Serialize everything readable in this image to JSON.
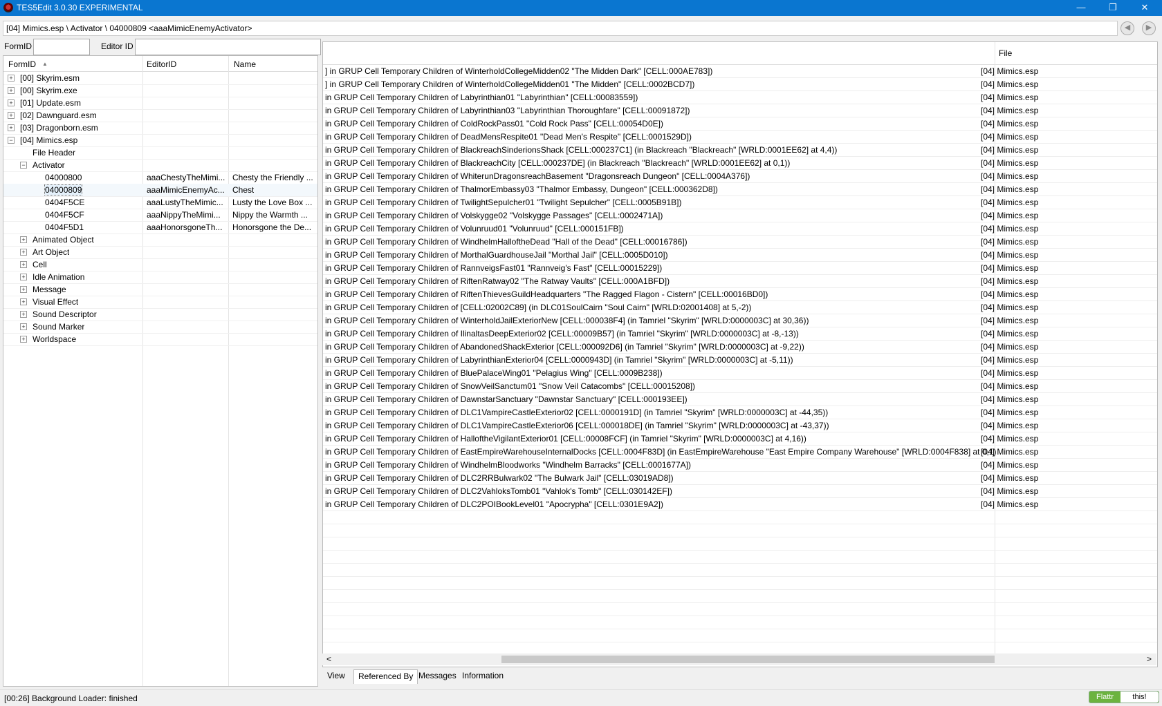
{
  "window": {
    "title": "TES5Edit 3.0.30 EXPERIMENTAL",
    "minimize": "—",
    "restore": "❐",
    "close": "✕"
  },
  "path": "[04] Mimics.esp \\ Activator \\ 04000809 <aaaMimicEnemyActivator>",
  "nav": {
    "back": "◀",
    "forward": "▶"
  },
  "filters": {
    "formid_label": "FormID",
    "formid_value": "",
    "editorid_label": "Editor ID",
    "editorid_value": ""
  },
  "tree": {
    "headers": {
      "formid": "FormID",
      "editorid": "EditorID",
      "name": "Name",
      "sort_indicator": "▲"
    },
    "rows": [
      {
        "exp": "+",
        "formid": "[00] Skyrim.esm",
        "editorid": "",
        "name": ""
      },
      {
        "exp": "+",
        "formid": "[00] Skyrim.exe",
        "editorid": "",
        "name": ""
      },
      {
        "exp": "+",
        "formid": "[01] Update.esm",
        "editorid": "",
        "name": ""
      },
      {
        "exp": "+",
        "formid": "[02] Dawnguard.esm",
        "editorid": "",
        "name": ""
      },
      {
        "exp": "+",
        "formid": "[03] Dragonborn.esm",
        "editorid": "",
        "name": ""
      },
      {
        "exp": "−",
        "formid": "[04] Mimics.esp",
        "editorid": "",
        "name": ""
      },
      {
        "exp": "",
        "formid": "File Header",
        "editorid": "",
        "name": ""
      },
      {
        "exp": "−",
        "formid": "Activator",
        "editorid": "",
        "name": ""
      },
      {
        "exp": "",
        "formid": "04000800",
        "editorid": "aaaChestyTheMimi...",
        "name": "Chesty the Friendly ..."
      },
      {
        "exp": "",
        "formid": "04000809",
        "editorid": "aaaMimicEnemyAc...",
        "name": "Chest"
      },
      {
        "exp": "",
        "formid": "0404F5CE",
        "editorid": "aaaLustyTheMimic...",
        "name": "Lusty the Love Box ..."
      },
      {
        "exp": "",
        "formid": "0404F5CF",
        "editorid": "aaaNippyTheMimi...",
        "name": "Nippy the Warmth ..."
      },
      {
        "exp": "",
        "formid": "0404F5D1",
        "editorid": "aaaHonorsgoneTh...",
        "name": "Honorsgone the De..."
      },
      {
        "exp": "+",
        "formid": "Animated Object",
        "editorid": "",
        "name": ""
      },
      {
        "exp": "+",
        "formid": "Art Object",
        "editorid": "",
        "name": ""
      },
      {
        "exp": "+",
        "formid": "Cell",
        "editorid": "",
        "name": ""
      },
      {
        "exp": "+",
        "formid": "Idle Animation",
        "editorid": "",
        "name": ""
      },
      {
        "exp": "+",
        "formid": "Message",
        "editorid": "",
        "name": ""
      },
      {
        "exp": "+",
        "formid": "Visual Effect",
        "editorid": "",
        "name": ""
      },
      {
        "exp": "+",
        "formid": "Sound Descriptor",
        "editorid": "",
        "name": ""
      },
      {
        "exp": "+",
        "formid": "Sound Marker",
        "editorid": "",
        "name": ""
      },
      {
        "exp": "+",
        "formid": "Worldspace",
        "editorid": "",
        "name": ""
      }
    ]
  },
  "refs": {
    "header_file": "File",
    "rows": [
      {
        "ref": "] in GRUP Cell Temporary Children of WinterholdCollegeMidden02 \"The Midden Dark\" [CELL:000AE783])",
        "file": "[04] Mimics.esp"
      },
      {
        "ref": "] in GRUP Cell Temporary Children of WinterholdCollegeMidden01 \"The Midden\" [CELL:0002BCD7])",
        "file": "[04] Mimics.esp"
      },
      {
        "ref": " in GRUP Cell Temporary Children of Labyrinthian01 \"Labyrinthian\" [CELL:00083559])",
        "file": "[04] Mimics.esp"
      },
      {
        "ref": " in GRUP Cell Temporary Children of Labyrinthian03 \"Labyrinthian Thoroughfare\" [CELL:00091872])",
        "file": "[04] Mimics.esp"
      },
      {
        "ref": " in GRUP Cell Temporary Children of ColdRockPass01 \"Cold Rock Pass\" [CELL:00054D0E])",
        "file": "[04] Mimics.esp"
      },
      {
        "ref": " in GRUP Cell Temporary Children of DeadMensRespite01 \"Dead Men's Respite\" [CELL:0001529D])",
        "file": "[04] Mimics.esp"
      },
      {
        "ref": " in GRUP Cell Temporary Children of BlackreachSinderionsShack [CELL:000237C1] (in Blackreach \"Blackreach\" [WRLD:0001EE62] at 4,4))",
        "file": "[04] Mimics.esp"
      },
      {
        "ref": " in GRUP Cell Temporary Children of BlackreachCity [CELL:000237DE] (in Blackreach \"Blackreach\" [WRLD:0001EE62] at 0,1))",
        "file": "[04] Mimics.esp"
      },
      {
        "ref": " in GRUP Cell Temporary Children of WhiterunDragonsreachBasement \"Dragonsreach Dungeon\" [CELL:0004A376])",
        "file": "[04] Mimics.esp"
      },
      {
        "ref": " in GRUP Cell Temporary Children of ThalmorEmbassy03 \"Thalmor Embassy, Dungeon\" [CELL:000362D8])",
        "file": "[04] Mimics.esp"
      },
      {
        "ref": " in GRUP Cell Temporary Children of TwilightSepulcher01 \"Twilight Sepulcher\" [CELL:0005B91B])",
        "file": "[04] Mimics.esp"
      },
      {
        "ref": " in GRUP Cell Temporary Children of Volskygge02 \"Volskygge Passages\" [CELL:0002471A])",
        "file": "[04] Mimics.esp"
      },
      {
        "ref": " in GRUP Cell Temporary Children of Volunruud01 \"Volunruud\" [CELL:000151FB])",
        "file": "[04] Mimics.esp"
      },
      {
        "ref": " in GRUP Cell Temporary Children of WindhelmHalloftheDead \"Hall of the Dead\" [CELL:00016786])",
        "file": "[04] Mimics.esp"
      },
      {
        "ref": " in GRUP Cell Temporary Children of MorthalGuardhouseJail \"Morthal Jail\" [CELL:0005D010])",
        "file": "[04] Mimics.esp"
      },
      {
        "ref": " in GRUP Cell Temporary Children of RannveigsFast01 \"Rannveig's Fast\" [CELL:00015229])",
        "file": "[04] Mimics.esp"
      },
      {
        "ref": " in GRUP Cell Temporary Children of RiftenRatway02 \"The Ratway Vaults\" [CELL:000A1BFD])",
        "file": "[04] Mimics.esp"
      },
      {
        "ref": " in GRUP Cell Temporary Children of RiftenThievesGuildHeadquarters \"The Ragged Flagon - Cistern\" [CELL:00016BD0])",
        "file": "[04] Mimics.esp"
      },
      {
        "ref": " in GRUP Cell Temporary Children of [CELL:02002C89] (in DLC01SoulCairn \"Soul Cairn\" [WRLD:02001408] at 5,-2))",
        "file": "[04] Mimics.esp"
      },
      {
        "ref": " in GRUP Cell Temporary Children of WinterholdJailExteriorNew [CELL:000038F4] (in Tamriel \"Skyrim\" [WRLD:0000003C] at 30,36))",
        "file": "[04] Mimics.esp"
      },
      {
        "ref": " in GRUP Cell Temporary Children of IlinaltasDeepExterior02 [CELL:00009B57] (in Tamriel \"Skyrim\" [WRLD:0000003C] at -8,-13))",
        "file": "[04] Mimics.esp"
      },
      {
        "ref": " in GRUP Cell Temporary Children of AbandonedShackExterior [CELL:000092D6] (in Tamriel \"Skyrim\" [WRLD:0000003C] at -9,22))",
        "file": "[04] Mimics.esp"
      },
      {
        "ref": " in GRUP Cell Temporary Children of LabyrinthianExterior04 [CELL:0000943D] (in Tamriel \"Skyrim\" [WRLD:0000003C] at -5,11))",
        "file": "[04] Mimics.esp"
      },
      {
        "ref": " in GRUP Cell Temporary Children of BluePalaceWing01 \"Pelagius Wing\" [CELL:0009B238])",
        "file": "[04] Mimics.esp"
      },
      {
        "ref": " in GRUP Cell Temporary Children of SnowVeilSanctum01 \"Snow Veil Catacombs\" [CELL:00015208])",
        "file": "[04] Mimics.esp"
      },
      {
        "ref": " in GRUP Cell Temporary Children of DawnstarSanctuary \"Dawnstar Sanctuary\" [CELL:000193EE])",
        "file": "[04] Mimics.esp"
      },
      {
        "ref": " in GRUP Cell Temporary Children of DLC1VampireCastleExterior02 [CELL:0000191D] (in Tamriel \"Skyrim\" [WRLD:0000003C] at -44,35))",
        "file": "[04] Mimics.esp"
      },
      {
        "ref": " in GRUP Cell Temporary Children of DLC1VampireCastleExterior06 [CELL:000018DE] (in Tamriel \"Skyrim\" [WRLD:0000003C] at -43,37))",
        "file": "[04] Mimics.esp"
      },
      {
        "ref": " in GRUP Cell Temporary Children of HalloftheVigilantExterior01 [CELL:00008FCF] (in Tamriel \"Skyrim\" [WRLD:0000003C] at 4,16))",
        "file": "[04] Mimics.esp"
      },
      {
        "ref": " in GRUP Cell Temporary Children of EastEmpireWarehouseInternalDocks [CELL:0004F83D] (in EastEmpireWarehouse \"East Empire Company Warehouse\" [WRLD:0004F838] at 0,1))",
        "file": "[04] Mimics.esp"
      },
      {
        "ref": " in GRUP Cell Temporary Children of WindhelmBloodworks \"Windhelm Barracks\" [CELL:0001677A])",
        "file": "[04] Mimics.esp"
      },
      {
        "ref": " in GRUP Cell Temporary Children of DLC2RRBulwark02 \"The Bulwark Jail\" [CELL:03019AD8])",
        "file": "[04] Mimics.esp"
      },
      {
        "ref": " in GRUP Cell Temporary Children of DLC2VahloksTomb01 \"Vahlok's Tomb\" [CELL:030142EF])",
        "file": "[04] Mimics.esp"
      },
      {
        "ref": " in GRUP Cell Temporary Children of DLC2POIBookLevel01 \"Apocrypha\" [CELL:0301E9A2])",
        "file": "[04] Mimics.esp"
      }
    ]
  },
  "scroll": {
    "left": "<",
    "right": ">"
  },
  "tabs": [
    {
      "label": "View",
      "active": false
    },
    {
      "label": "Referenced By",
      "active": true
    },
    {
      "label": "Messages",
      "active": false
    },
    {
      "label": "Information",
      "active": false
    }
  ],
  "status": "[00:26] Background Loader: finished",
  "flattr": {
    "left": "Flattr",
    "right": "this!"
  }
}
